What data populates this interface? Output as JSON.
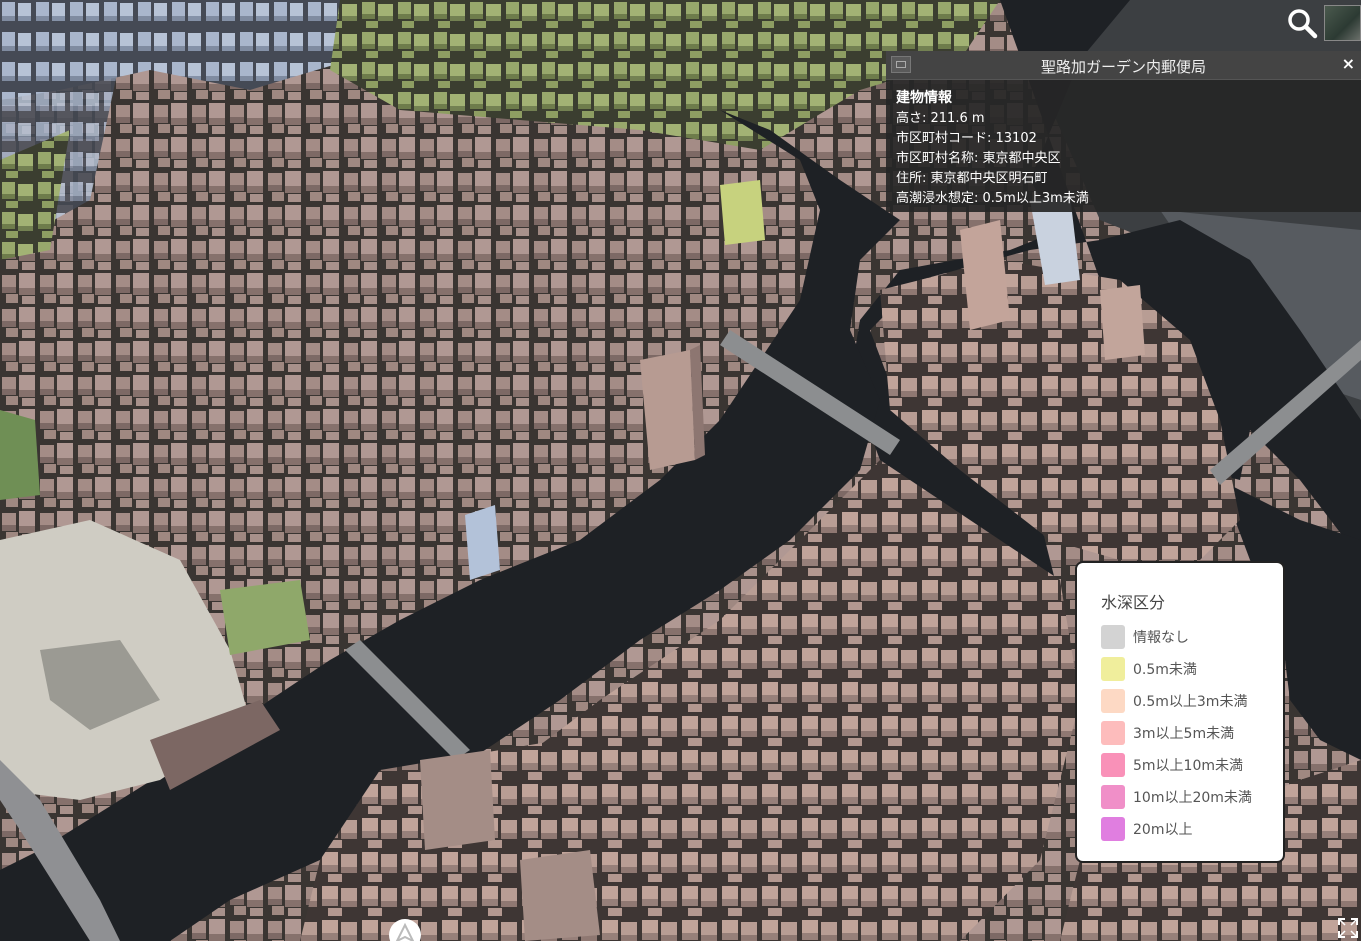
{
  "infobox": {
    "title": "聖路加ガーデン内郵便局",
    "close_label": "×",
    "heading": "建物情報",
    "lines": [
      "高さ: 211.6 m",
      "市区町村コード: 13102",
      "市区町村名称: 東京都中央区",
      "住所: 東京都中央区明石町",
      "高潮浸水想定: 0.5m以上3m未満"
    ]
  },
  "legend": {
    "title": "水深区分",
    "items": [
      {
        "label": "情報なし",
        "color": "#d3d3d3"
      },
      {
        "label": "0.5m未満",
        "color": "#f0ee9c"
      },
      {
        "label": "0.5m以上3m未満",
        "color": "#fdd9c4"
      },
      {
        "label": "3m以上5m未満",
        "color": "#fdbcbc"
      },
      {
        "label": "5m以上10m未満",
        "color": "#f991b8"
      },
      {
        "label": "10m以上20m未満",
        "color": "#f08fc8"
      },
      {
        "label": "20m以上",
        "color": "#e07ee0"
      }
    ]
  },
  "toolbar": {
    "search_icon": "search-icon",
    "layer_icon": "base-layer-picker-icon",
    "fullscreen_icon": "fullscreen-icon",
    "compass_icon": "navigation-compass-icon"
  },
  "colors": {
    "building_default": "#9c8682",
    "building_flood": "#b19a93",
    "building_green": "#8a9c62",
    "building_blue": "#9fb0c8",
    "water": "#1e2125"
  }
}
